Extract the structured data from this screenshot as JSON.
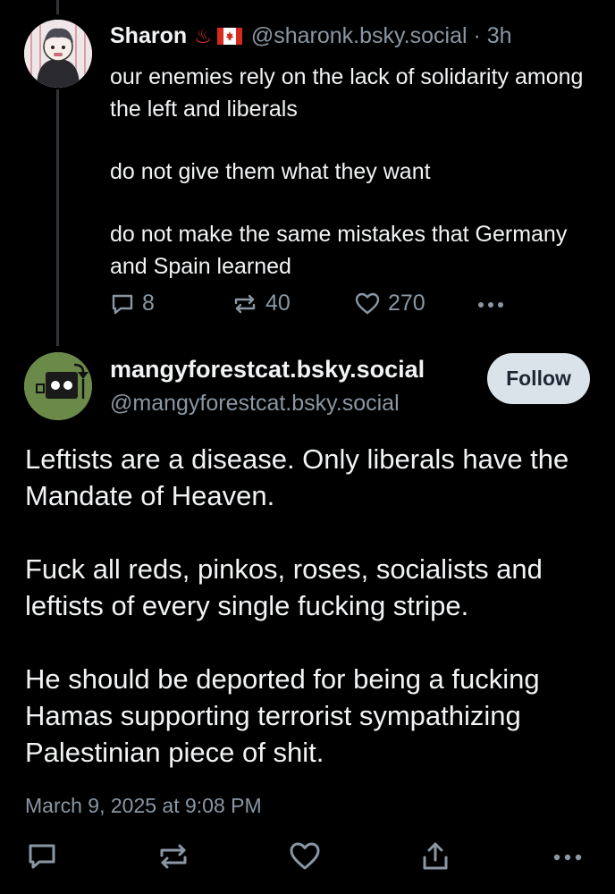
{
  "parent_post": {
    "author_name": "Sharon",
    "author_emoji": "♨",
    "author_flag": "canada-flag",
    "author_handle": "@sharonk.bsky.social",
    "separator": "·",
    "time": "3h",
    "text": [
      "our enemies rely on the lack of solidarity among the left and liberals",
      "do not give them what they want",
      "do not make the same mistakes that Germany and Spain learned"
    ],
    "replies": "8",
    "reposts": "40",
    "likes": "270",
    "icons": [
      "reply-icon",
      "repost-icon",
      "like-icon",
      "more-icon"
    ]
  },
  "main_post": {
    "author_name": "mangyforestcat.bsky.social",
    "author_handle": "@mangyforestcat.bsky.social",
    "follow_label": "Follow",
    "text": [
      "Leftists are a disease. Only liberals have the Mandate of Heaven.",
      "Fuck all reds, pinkos, roses, socialists and leftists of every single fucking stripe.",
      "He should be deported for being a fucking Hamas supporting terrorist sympathizing Palestinian piece of shit."
    ],
    "date": "March 9, 2025 at 9:08 PM",
    "icons": [
      "reply-icon",
      "repost-icon",
      "like-icon",
      "share-icon",
      "more-icon"
    ]
  },
  "colors": {
    "background": "#000000",
    "text": "#f1f3f5",
    "muted": "#8a97a3",
    "thread_line": "#2e3438",
    "follow_bg": "#dbe3ea",
    "avatar2_bg": "#6b8a4a"
  }
}
